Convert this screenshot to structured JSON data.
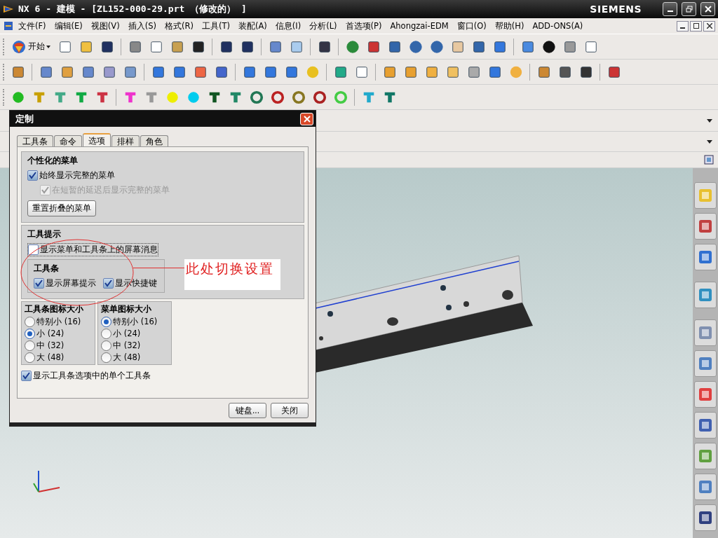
{
  "window": {
    "title": "NX 6 - 建模 - [ZL152-000-29.prt （修改的） ]",
    "brand": "SIEMENS"
  },
  "menu_bar": [
    "文件(F)",
    "编辑(E)",
    "视图(V)",
    "插入(S)",
    "格式(R)",
    "工具(T)",
    "装配(A)",
    "信息(I)",
    "分析(L)",
    "首选项(P)",
    "Ahongzai-EDM",
    "窗口(O)",
    "帮助(H)",
    "ADD-ONS(A)"
  ],
  "toolbar": {
    "start_label": "开始"
  },
  "dialog": {
    "title": "定制",
    "tabs": [
      {
        "label": "工具条",
        "selected": false
      },
      {
        "label": "命令",
        "selected": false
      },
      {
        "label": "选项",
        "selected": true
      },
      {
        "label": "排样",
        "selected": false
      },
      {
        "label": "角色",
        "selected": false
      }
    ],
    "personalized_menus": {
      "heading": "个性化的菜单",
      "options": [
        {
          "label": "始终显示完整的菜单",
          "checked": true,
          "disabled": false
        },
        {
          "label": "在短暂的延迟后显示完整的菜单",
          "checked": true,
          "disabled": true
        }
      ],
      "reset_button": "重置折叠的菜单"
    },
    "tooltips": {
      "heading": "工具提示",
      "option": {
        "label": "显示菜单和工具条上的屏幕消息",
        "checked": false
      },
      "toolbar_group": {
        "heading": "工具条",
        "options": [
          {
            "label": "显示屏幕提示",
            "checked": true
          },
          {
            "label": "显示快捷键",
            "checked": true
          }
        ]
      }
    },
    "icon_sizes": [
      {
        "heading": "工具条图标大小",
        "options": [
          {
            "label": "特别小 (16)",
            "selected": false
          },
          {
            "label": "小 (24)",
            "selected": true
          },
          {
            "label": "中 (32)",
            "selected": false
          },
          {
            "label": "大 (48)",
            "selected": false
          }
        ]
      },
      {
        "heading": "菜单图标大小",
        "options": [
          {
            "label": "特别小 (16)",
            "selected": true
          },
          {
            "label": "小 (24)",
            "selected": false
          },
          {
            "label": "中 (32)",
            "selected": false
          },
          {
            "label": "大 (48)",
            "selected": false
          }
        ]
      }
    ],
    "single_toolbars": {
      "label": "显示工具条选项中的单个工具条",
      "checked": true
    },
    "buttons": [
      "键盘...",
      "关闭"
    ]
  },
  "annotation": {
    "text": "此处切换设置"
  }
}
